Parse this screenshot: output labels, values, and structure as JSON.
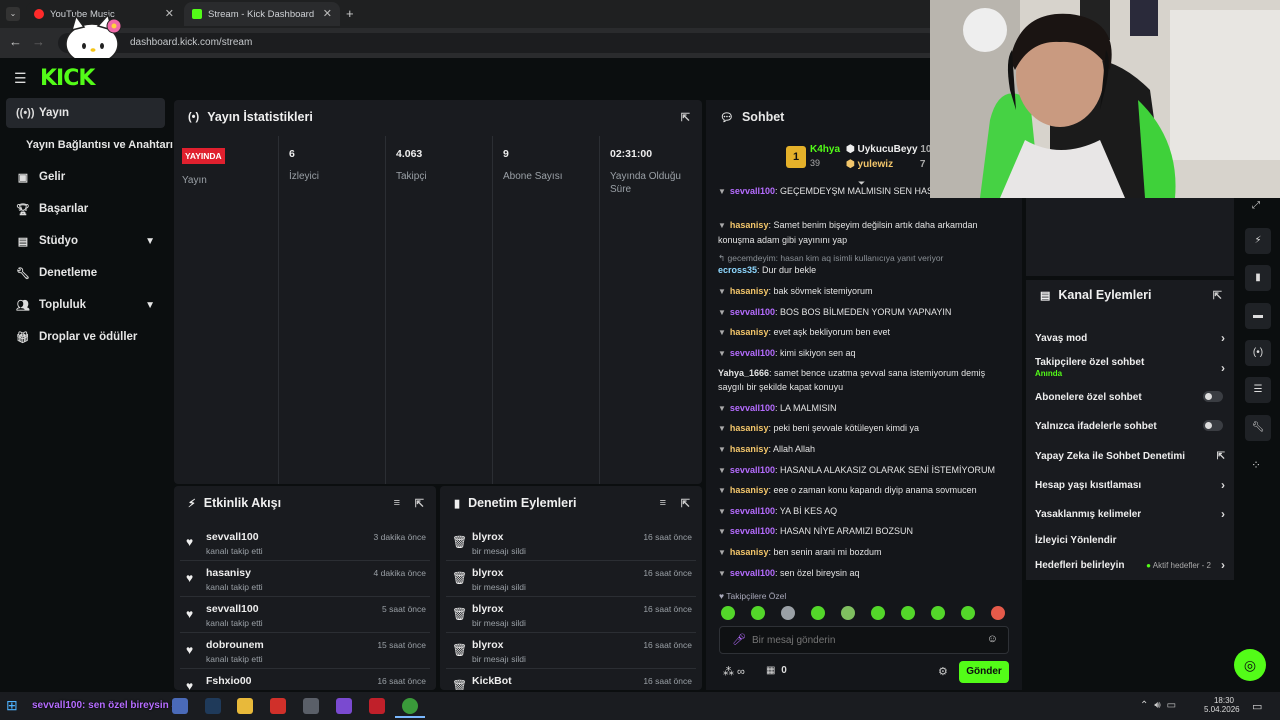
{
  "browser": {
    "tabs": [
      {
        "title": "YouTube Music"
      },
      {
        "title": "Stream - Kick Dashboard"
      }
    ],
    "new_tab": "+",
    "url": "dashboard.kick.com/stream"
  },
  "logo": "KICK",
  "sidebar": {
    "items": [
      {
        "label": "Yayın",
        "icon": "broadcast-icon"
      },
      {
        "label": "Yayın Bağlantısı ve Anahtarı"
      },
      {
        "label": "Gelir",
        "icon": "wallet-icon"
      },
      {
        "label": "Başarılar",
        "icon": "trophy-icon"
      },
      {
        "label": "Stüdyo",
        "icon": "studio-icon"
      },
      {
        "label": "Denetleme",
        "icon": "wrench-icon"
      },
      {
        "label": "Topluluk",
        "icon": "people-icon"
      },
      {
        "label": "Droplar ve ödüller",
        "icon": "gift-icon"
      }
    ]
  },
  "stats": {
    "title": "Yayın İstatistikleri",
    "status_badge": "YAYINDA",
    "status_label": "Yayın",
    "items": [
      {
        "value": "6",
        "label": "İzleyici"
      },
      {
        "value": "4.063",
        "label": "Takipçi"
      },
      {
        "value": "9",
        "label": "Abone Sayısı"
      },
      {
        "value": "02:31:00",
        "label": "Yayında Olduğu Süre"
      }
    ]
  },
  "activity": {
    "title": "Etkinlik Akışı",
    "items": [
      {
        "name": "sevvall100",
        "sub": "kanalı takip etti",
        "time": "3 dakika önce"
      },
      {
        "name": "hasanisy",
        "sub": "kanalı takip etti",
        "time": "4 dakika önce"
      },
      {
        "name": "sevvall100",
        "sub": "kanalı takip etti",
        "time": "5 saat önce"
      },
      {
        "name": "dobrounem",
        "sub": "kanalı takip etti",
        "time": "15 saat önce"
      },
      {
        "name": "Fshxio00",
        "sub": "",
        "time": "16 saat önce"
      }
    ]
  },
  "moderation": {
    "title": "Denetim Eylemleri",
    "items": [
      {
        "name": "blyrox",
        "sub": "bir mesajı sildi",
        "time": "16 saat önce"
      },
      {
        "name": "blyrox",
        "sub": "bir mesajı sildi",
        "time": "16 saat önce"
      },
      {
        "name": "blyrox",
        "sub": "bir mesajı sildi",
        "time": "16 saat önce"
      },
      {
        "name": "blyrox",
        "sub": "bir mesajı sildi",
        "time": "16 saat önce"
      },
      {
        "name": "KickBot",
        "sub": "",
        "time": "16 saat önce"
      }
    ]
  },
  "chat": {
    "title": "Sohbet",
    "leaderboard": {
      "rank": "1",
      "first_name": "K4hya",
      "first_count": "39",
      "second_name": "UykucuBeyy",
      "second_count": "10",
      "third_name": "yulewiz",
      "third_count": "7"
    },
    "messages": [
      {
        "user": "sevvall100",
        "text": ": GEÇEMDEYŞM MALMISIN SEN HAS YOK",
        "color": "#b56cff"
      },
      {
        "user": "hasanisy",
        "text": ": Samet benim bişeyim değilsin artık daha arkamdan konuşma adam gibi yayınını yap",
        "color": "#f3c66b"
      },
      {
        "user": "ecross35",
        "text": ": Dur dur bekle",
        "color": "#8fd8ff",
        "reply": "gecemdeyim: hasan kim aq isimli kullanıcıya yanıt veriyor"
      },
      {
        "user": "hasanisy",
        "text": ": bak sövmek istemiyorum",
        "color": "#f3c66b"
      },
      {
        "user": "sevvall100",
        "text": ": BOS BOS BİLMEDEN YORUM YAPNAYIN",
        "color": "#b56cff"
      },
      {
        "user": "hasanisy",
        "text": ": evet aşk bekliyorum ben evet",
        "color": "#f3c66b"
      },
      {
        "user": "sevvall100",
        "text": ": kimi sikiyon sen aq",
        "color": "#b56cff"
      },
      {
        "user": "Yahya_1666",
        "text": ": samet bence uzatma şevval sana istemiyorum demiş saygılı bir şekilde kapat konuyu",
        "color": "#ffffff"
      },
      {
        "user": "sevvall100",
        "text": ": LA MALMISIN",
        "color": "#b56cff"
      },
      {
        "user": "hasanisy",
        "text": ": peki beni şevvale kötüleyen kimdi ya",
        "color": "#f3c66b"
      },
      {
        "user": "hasanisy",
        "text": ": Allah Allah",
        "color": "#f3c66b"
      },
      {
        "user": "sevvall100",
        "text": ": HASANLA ALAKASIZ OLARAK SENİ İSTEMİYORUM",
        "color": "#b56cff"
      },
      {
        "user": "hasanisy",
        "text": ": eee o zaman konu kapandı diyip anama sovmucen",
        "color": "#f3c66b"
      },
      {
        "user": "sevvall100",
        "text": ": YA Bİ KES AQ",
        "color": "#b56cff"
      },
      {
        "user": "sevvall100",
        "text": ": HASAN NİYE ARAMIZI BOZSUN",
        "color": "#b56cff"
      },
      {
        "user": "hasanisy",
        "text": ": ben senin arani mi bozdum",
        "color": "#f3c66b"
      },
      {
        "user": "sevvall100",
        "text": ": sen özel bireysin aq",
        "color": "#b56cff"
      }
    ],
    "followers_only": "Takipçilere Özel",
    "input_placeholder": "Bir mesaj gönderin",
    "infinity": "∞",
    "zero": "0",
    "send": "Gönder"
  },
  "channel_actions": {
    "title": "Kanal Eylemleri",
    "items": [
      {
        "label": "Yavaş mod",
        "kind": "arrow"
      },
      {
        "label": "Takipçilere özel sohbet",
        "sub": "Anında",
        "kind": "arrow"
      },
      {
        "label": "Abonelere özel sohbet",
        "kind": "toggle"
      },
      {
        "label": "Yalnızca ifadelerle sohbet",
        "kind": "toggle"
      },
      {
        "label": "Yapay Zeka ile Sohbet Denetimi",
        "kind": "external"
      },
      {
        "label": "Hesap yaşı kısıtlaması",
        "kind": "arrow"
      },
      {
        "label": "Yasaklanmış kelimeler",
        "kind": "arrow"
      },
      {
        "label": "İzleyici Yönlendir",
        "kind": "none"
      },
      {
        "label": "Hedefleri belirleyin",
        "sub": "Aktif hedefler - 2",
        "kind": "arrow"
      }
    ]
  },
  "overlay_chat": "sevvall100: sen özel bireysin aq",
  "taskbar": {
    "time": "18:30",
    "date": "5.04.2026"
  },
  "colors": {
    "accent": "#53fc18",
    "live": "#e0202e"
  }
}
